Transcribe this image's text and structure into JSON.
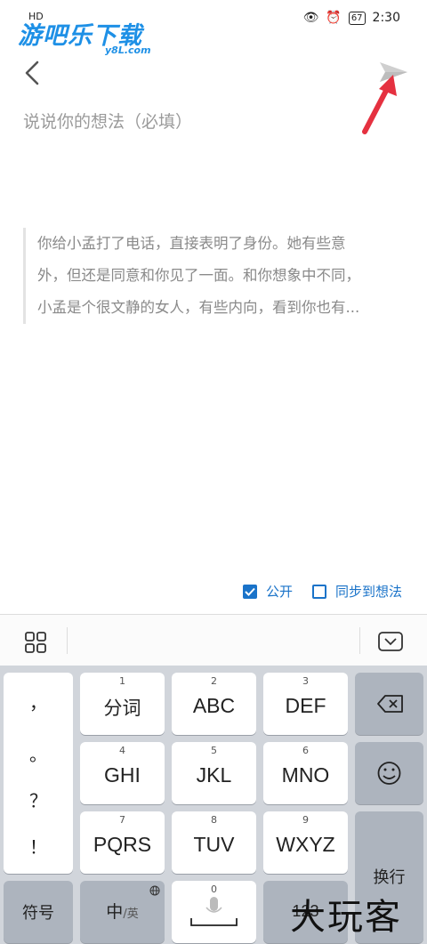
{
  "status": {
    "left_text": "HD",
    "battery": "67",
    "time": "2:30"
  },
  "watermark_top": {
    "title": "游吧乐下载",
    "sub": "y8L.com"
  },
  "composer": {
    "placeholder": "说说你的想法（必填）",
    "quote_lines": [
      "你给小孟打了电话，直接表明了身份。她有些意",
      "外，但还是同意和你见了一面。和你想象中不同，",
      "小孟是个很文静的女人，有些内向，看到你也有..."
    ]
  },
  "options": {
    "public_label": "公开",
    "public_checked": true,
    "sync_label": "同步到想法",
    "sync_checked": false
  },
  "keyboard": {
    "punct": [
      "，",
      "。",
      "？",
      "！"
    ],
    "keys": [
      {
        "num": "1",
        "label": "分词"
      },
      {
        "num": "2",
        "label": "ABC"
      },
      {
        "num": "3",
        "label": "DEF"
      },
      {
        "num": "4",
        "label": "GHI"
      },
      {
        "num": "5",
        "label": "JKL"
      },
      {
        "num": "6",
        "label": "MNO"
      },
      {
        "num": "7",
        "label": "PQRS"
      },
      {
        "num": "8",
        "label": "TUV"
      },
      {
        "num": "9",
        "label": "WXYZ"
      }
    ],
    "enter_label": "换行",
    "symbol_label": "符号",
    "lang_main": "中",
    "lang_sub": "/英",
    "space_num": "0",
    "num_label": "123"
  },
  "watermark_bottom": "大玩客",
  "colors": {
    "accent": "#1a73c9",
    "annotation_arrow": "#e53140",
    "keyboard_bg": "#d1d5db"
  },
  "icons": [
    "back-chevron-icon",
    "send-paper-plane-icon",
    "grid-icon",
    "keyboard-hide-icon",
    "backspace-icon",
    "emoji-icon",
    "microphone-icon",
    "globe-icon"
  ]
}
